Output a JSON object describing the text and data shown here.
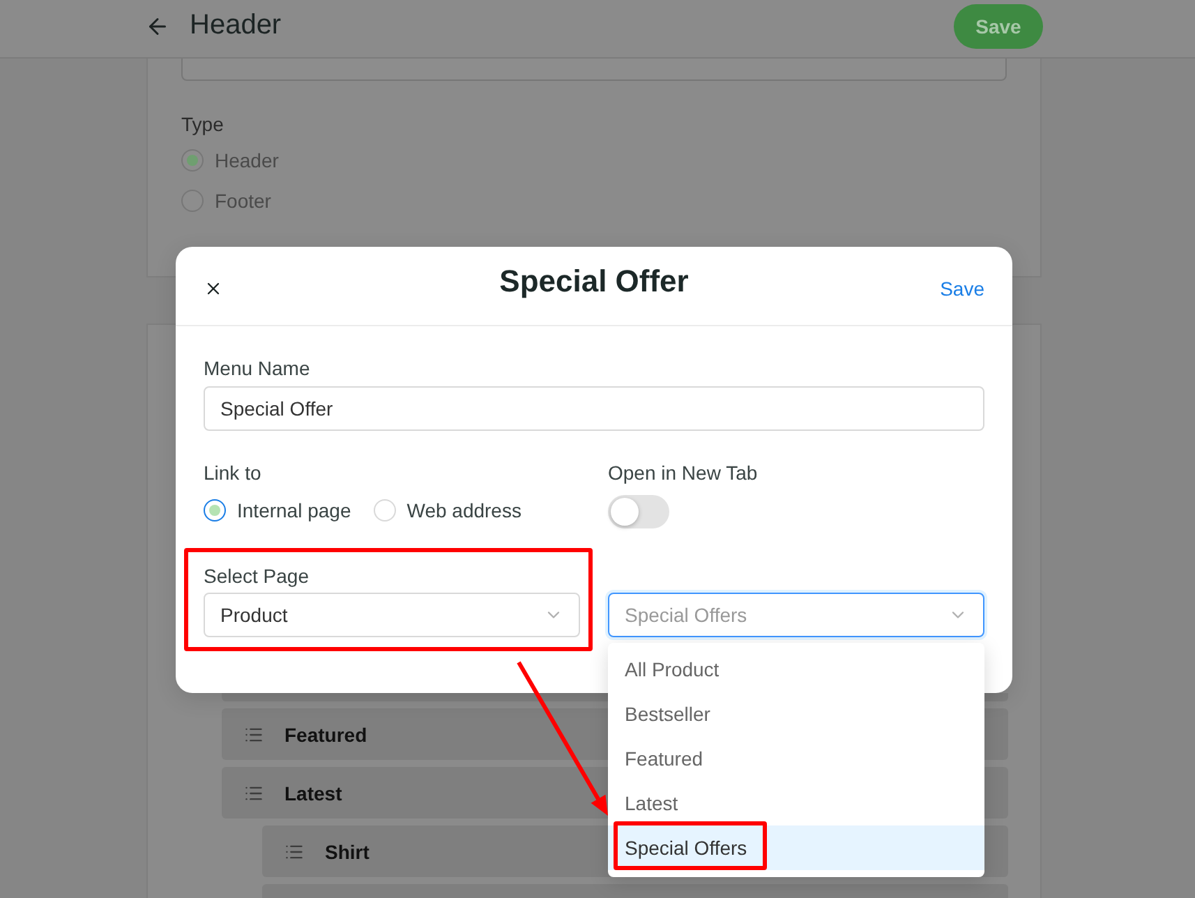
{
  "top_bar": {
    "title": "Header",
    "save_button": "Save"
  },
  "menu_card": {
    "type_label": "Type",
    "type_options": [
      {
        "label": "Header",
        "selected": true,
        "disabled": true
      },
      {
        "label": "Footer",
        "selected": false,
        "disabled": true
      }
    ]
  },
  "menu_items": [
    {
      "label": "Featured"
    },
    {
      "label": "Latest",
      "children": [
        {
          "label": "Shirt"
        }
      ]
    }
  ],
  "modal": {
    "title": "Special Offer",
    "save_link": "Save",
    "menu_name": {
      "label": "Menu Name",
      "value": "Special Offer"
    },
    "link_to": {
      "label": "Link to",
      "options": [
        {
          "label": "Internal page",
          "selected": true
        },
        {
          "label": "Web address",
          "selected": false
        }
      ]
    },
    "open_in_new_tab": {
      "label": "Open in New Tab",
      "on": false
    },
    "select_page": {
      "label": "Select Page",
      "value": "Product"
    },
    "target_page": {
      "value": "Special Offers",
      "expanded": true,
      "options": [
        {
          "label": "All Product",
          "selected": false
        },
        {
          "label": "Bestseller",
          "selected": false
        },
        {
          "label": "Featured",
          "selected": false
        },
        {
          "label": "Latest",
          "selected": false
        },
        {
          "label": "Special Offers",
          "selected": true
        }
      ]
    }
  }
}
